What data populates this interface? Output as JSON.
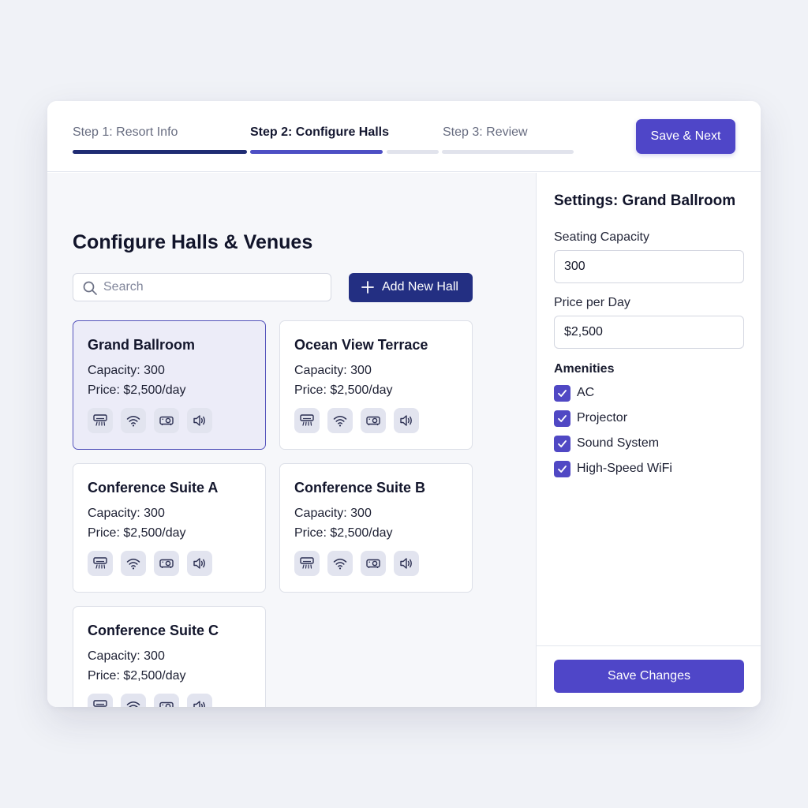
{
  "stepper": {
    "steps": [
      {
        "label": "Step 1: Resort Info",
        "state": "done"
      },
      {
        "label": "Step 2: Configure Halls",
        "state": "current"
      },
      {
        "label": "Step 3: Review",
        "state": "upcoming"
      }
    ],
    "save_next_label": "Save & Next"
  },
  "main": {
    "title": "Configure Halls & Venues",
    "search_placeholder": "Search",
    "add_hall_label": "Add New Hall",
    "halls": [
      {
        "name": "Grand Ballroom",
        "capacity": "Capacity: 300",
        "price": "Price: $2,500/day",
        "selected": true
      },
      {
        "name": "Ocean View Terrace",
        "capacity": "Capacity: 300",
        "price": "Price: $2,500/day",
        "selected": false
      },
      {
        "name": "Conference Suite A",
        "capacity": "Capacity: 300",
        "price": "Price: $2,500/day",
        "selected": false
      },
      {
        "name": "Conference Suite B",
        "capacity": "Capacity: 300",
        "price": "Price: $2,500/day",
        "selected": false
      },
      {
        "name": "Conference Suite C",
        "capacity": "Capacity: 300",
        "price": "Price: $2,500/day",
        "selected": false
      }
    ],
    "amenity_icons": [
      "ac-icon",
      "wifi-icon",
      "projector-icon",
      "speaker-icon"
    ]
  },
  "sidebar": {
    "title": "Settings: Grand Ballroom",
    "capacity_label": "Seating Capacity",
    "capacity_value": "300",
    "price_label": "Price per Day",
    "price_value": "$2,500",
    "amenities_label": "Amenities",
    "amenities": [
      {
        "label": "AC",
        "checked": true
      },
      {
        "label": "Projector",
        "checked": true
      },
      {
        "label": "Sound System",
        "checked": true
      },
      {
        "label": "High-Speed WiFi",
        "checked": true
      }
    ],
    "save_label": "Save Changes"
  },
  "colors": {
    "accent": "#4f46c8",
    "navy": "#232f82",
    "progress_done": "#1f2c73",
    "selected_card_bg": "#ececf8"
  }
}
